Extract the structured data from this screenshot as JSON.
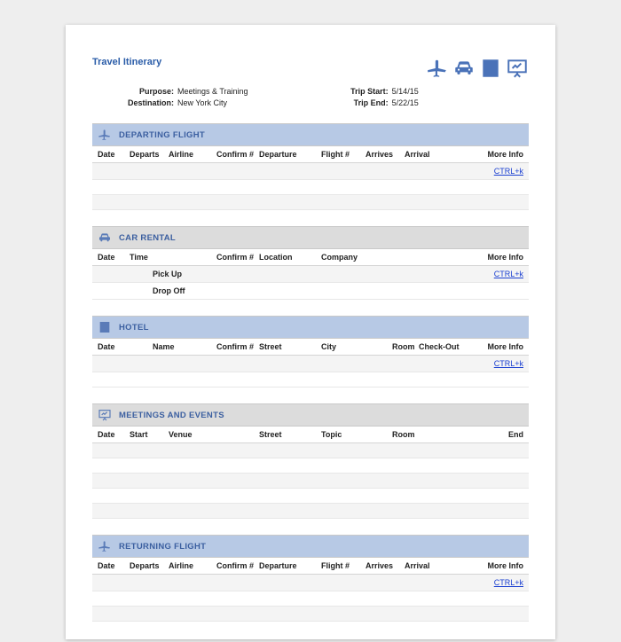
{
  "title": "Travel Itinerary",
  "meta": {
    "purpose_label": "Purpose:",
    "purpose": "Meetings & Training",
    "destination_label": "Destination:",
    "destination": "New York City",
    "trip_start_label": "Trip Start:",
    "trip_start": "5/14/15",
    "trip_end_label": "Trip End:",
    "trip_end": "5/22/15"
  },
  "more_info_label": "More Info",
  "more_info_link": "CTRL+k",
  "sections": {
    "departing": {
      "title": "DEPARTING FLIGHT",
      "cols": {
        "date": "Date",
        "departs": "Departs",
        "airline": "Airline",
        "confirm": "Confirm #",
        "departure": "Departure",
        "flight": "Flight #",
        "arrives": "Arrives",
        "arrival": "Arrival"
      }
    },
    "car": {
      "title": "CAR RENTAL",
      "cols": {
        "date": "Date",
        "time": "Time",
        "confirm": "Confirm #",
        "location": "Location",
        "company": "Company"
      },
      "rows": {
        "pickup": "Pick Up",
        "dropoff": "Drop Off"
      }
    },
    "hotel": {
      "title": "HOTEL",
      "cols": {
        "date": "Date",
        "name": "Name",
        "confirm": "Confirm #",
        "street": "Street",
        "city": "City",
        "room": "Room",
        "checkout": "Check-Out"
      }
    },
    "meetings": {
      "title": "MEETINGS AND EVENTS",
      "cols": {
        "date": "Date",
        "start": "Start",
        "venue": "Venue",
        "street": "Street",
        "topic": "Topic",
        "room": "Room",
        "end": "End"
      }
    },
    "returning": {
      "title": "RETURNING FLIGHT",
      "cols": {
        "date": "Date",
        "departs": "Departs",
        "airline": "Airline",
        "confirm": "Confirm #",
        "departure": "Departure",
        "flight": "Flight #",
        "arrives": "Arrives",
        "arrival": "Arrival"
      }
    }
  }
}
